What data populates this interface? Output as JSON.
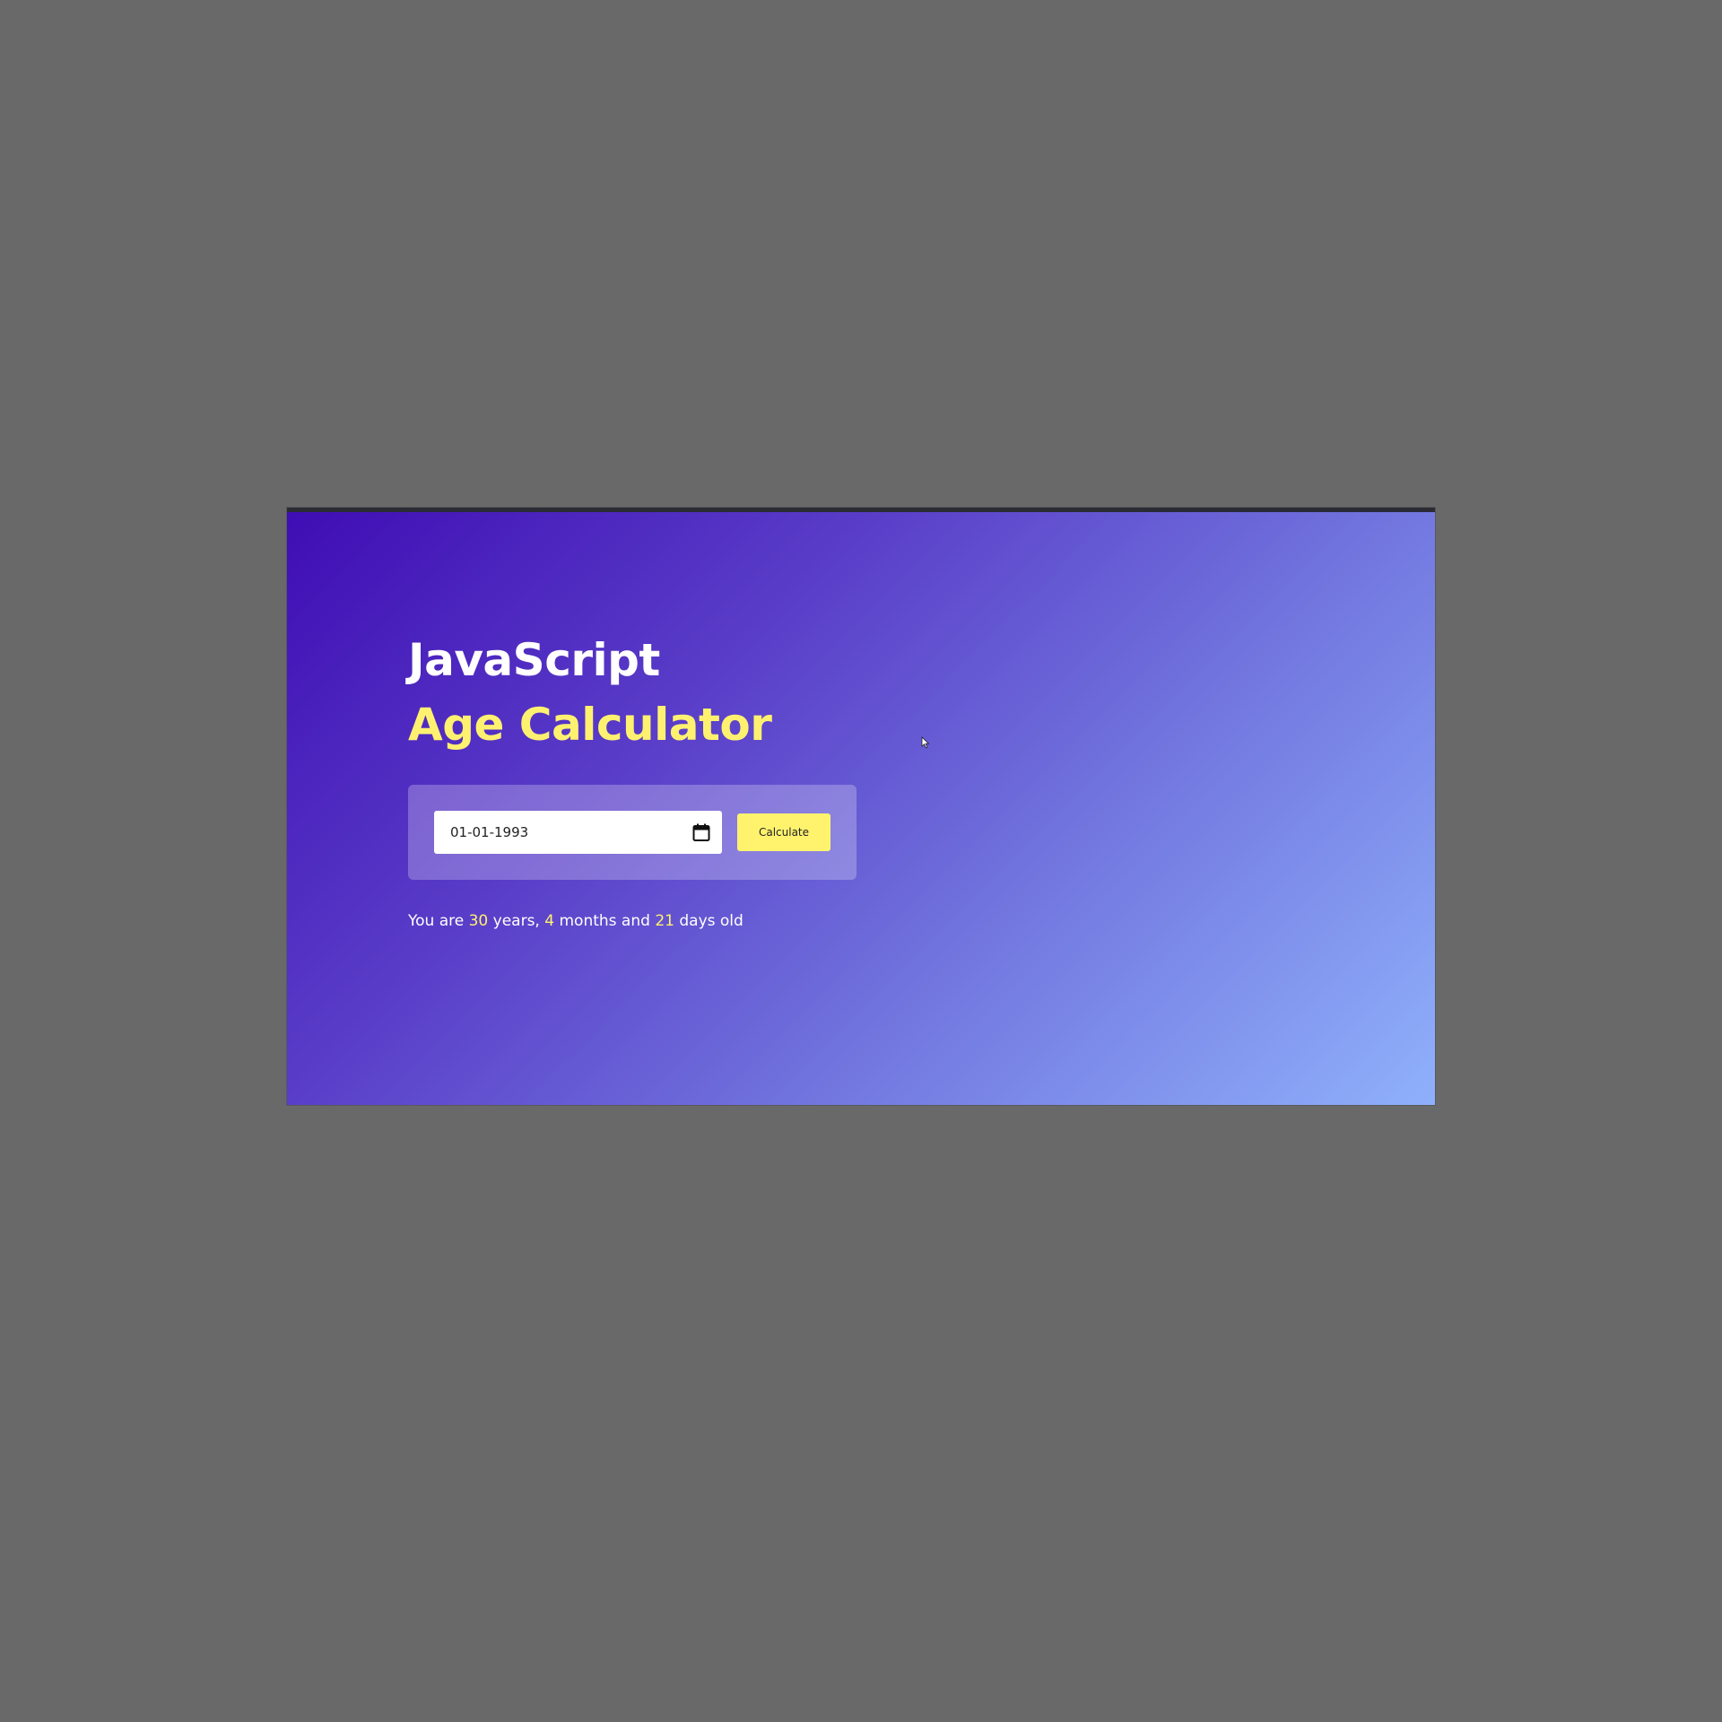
{
  "app": {
    "title_line1": "JavaScript",
    "title_line2": "Age Calculator"
  },
  "form": {
    "date_value": "01-01-1993",
    "calendar_icon": "calendar-icon",
    "button_label": "Calculate"
  },
  "result": {
    "prefix": "You are ",
    "years": "30",
    "years_label": " years, ",
    "months": "4",
    "months_label": " months and ",
    "days": "21",
    "days_label": " days old"
  },
  "colors": {
    "accent_yellow": "#fff170",
    "button_yellow": "#fff36e",
    "gradient_start": "#3f0db4",
    "gradient_end": "#8fb0fb",
    "outer_background": "#696969"
  }
}
